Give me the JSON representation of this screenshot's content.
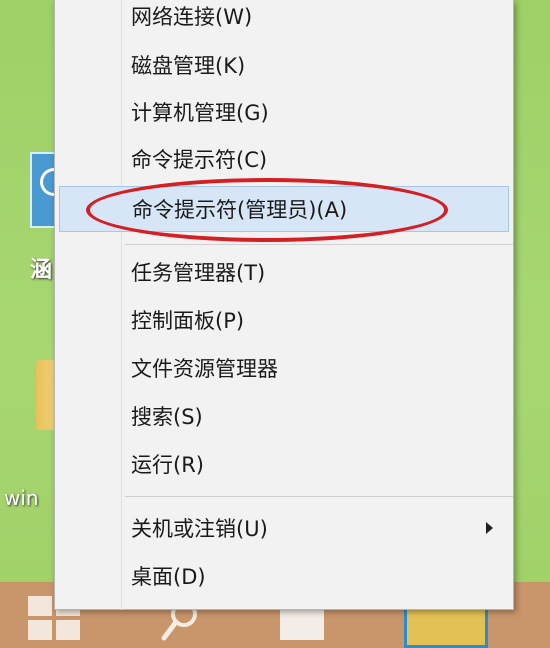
{
  "menu": {
    "items": [
      {
        "label": "网络连接(W)"
      },
      {
        "label": "磁盘管理(K)"
      },
      {
        "label": "计算机管理(G)"
      },
      {
        "label": "命令提示符(C)"
      },
      {
        "label": "命令提示符(管理员)(A)"
      },
      {
        "label": "任务管理器(T)"
      },
      {
        "label": "控制面板(P)"
      },
      {
        "label": "文件资源管理器"
      },
      {
        "label": "搜索(S)"
      },
      {
        "label": "运行(R)"
      },
      {
        "label": "关机或注销(U)"
      },
      {
        "label": "桌面(D)"
      }
    ]
  },
  "desktop": {
    "icon1_label": "涵",
    "icon2_label": "win"
  },
  "colors": {
    "highlight": "#d7e6f6",
    "annotation": "#d41f24",
    "taskbar": "#c9956b",
    "desktop": "#a7d46a"
  },
  "icons": [
    "start-icon",
    "search-icon",
    "document-icon",
    "folder-icon",
    "chevron-right-icon"
  ]
}
